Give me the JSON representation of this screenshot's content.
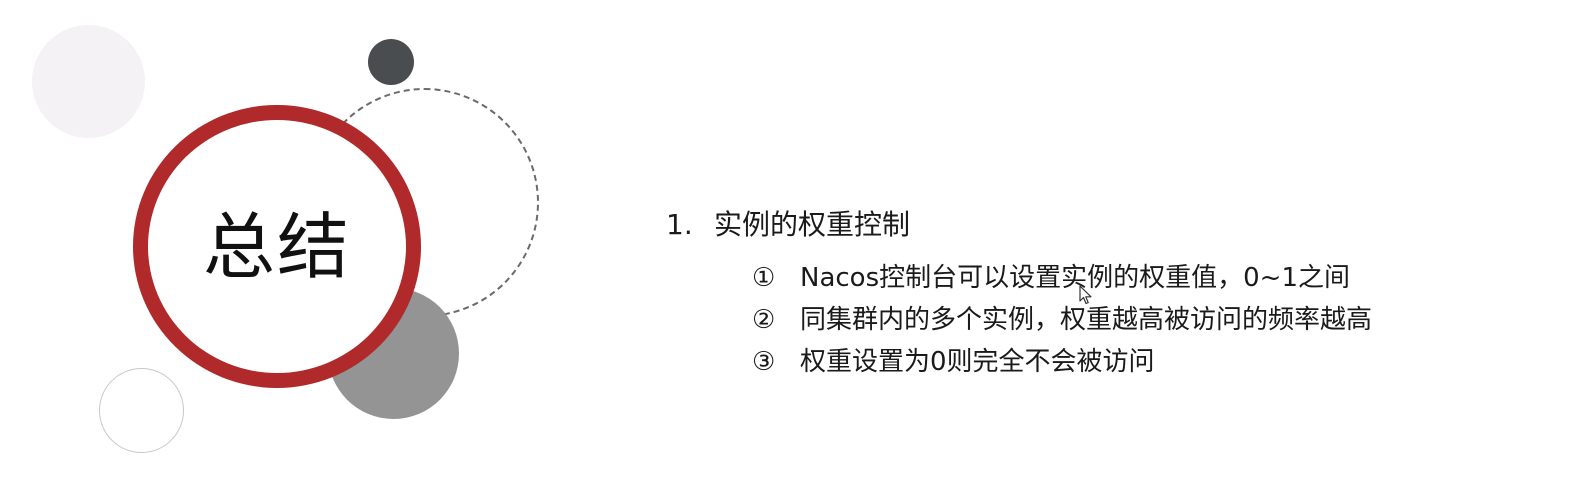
{
  "slide": {
    "title": "总结",
    "section": {
      "number": "1.",
      "heading": "实例的权重控制"
    },
    "points": [
      {
        "marker": "①",
        "text": "Nacos控制台可以设置实例的权重值，0~1之间"
      },
      {
        "marker": "②",
        "text": "同集群内的多个实例，权重越高被访问的频率越高"
      },
      {
        "marker": "③",
        "text": "权重设置为0则完全不会被访问"
      }
    ]
  },
  "colors": {
    "accent_red": "#b0292b",
    "dark_gray": "#4a4d4f",
    "mid_gray": "#949494",
    "light_gray": "#f4f2f4",
    "text": "#1a1a1a"
  },
  "icons": {
    "cursor": "mouse-pointer-icon"
  }
}
